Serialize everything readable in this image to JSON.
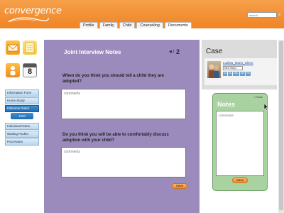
{
  "header": {
    "logo_text": "convergence",
    "search": {
      "placeholder": "search"
    },
    "tabs": [
      {
        "label": "Profile"
      },
      {
        "label": "Family"
      },
      {
        "label": "Child"
      },
      {
        "label": "Counseling"
      },
      {
        "label": "Documents"
      }
    ],
    "active_tab": "Documents"
  },
  "side_icons": {
    "calendar_number": "8",
    "icons": [
      "mail-icon",
      "notepad-icon",
      "person-icon",
      "calendar-icon"
    ]
  },
  "sidebar": {
    "items": [
      {
        "label": "Information Form"
      },
      {
        "label": "Home Study"
      },
      {
        "label": "Interview Notes"
      },
      {
        "label": "Individual Notes"
      },
      {
        "label": "Waiting Packet"
      },
      {
        "label": "Post Notes"
      }
    ],
    "sub_item": {
      "label": "Joint"
    },
    "active_item": "Interview Notes"
  },
  "main": {
    "title": "Joint Interview Notes",
    "page_prev": "◀ 1",
    "page_current": "2",
    "questions": [
      {
        "text": "When do you think you should tell a child they are adopted?",
        "placeholder": "comments"
      },
      {
        "text": "Do you think you will be able to comfortably discuss adoption with your child?",
        "placeholder": "comments"
      }
    ],
    "save_label": "Save"
  },
  "case": {
    "title": "Case",
    "name": "Ludlow_Mario_Glenn",
    "select_value": "Next Steps",
    "codes": [
      "04",
      "04",
      "2ND",
      "WP",
      "PA"
    ]
  },
  "notes": {
    "title": "Notes",
    "close_label": "× Close",
    "placeholder": "comments",
    "save_label": "Save"
  },
  "colors": {
    "header": "#ef8425",
    "main_panel": "#9b8bbd",
    "notes_panel": "#a8d3a0",
    "nav_active": "#1f6cb5",
    "save_button": "#f28a2c"
  }
}
